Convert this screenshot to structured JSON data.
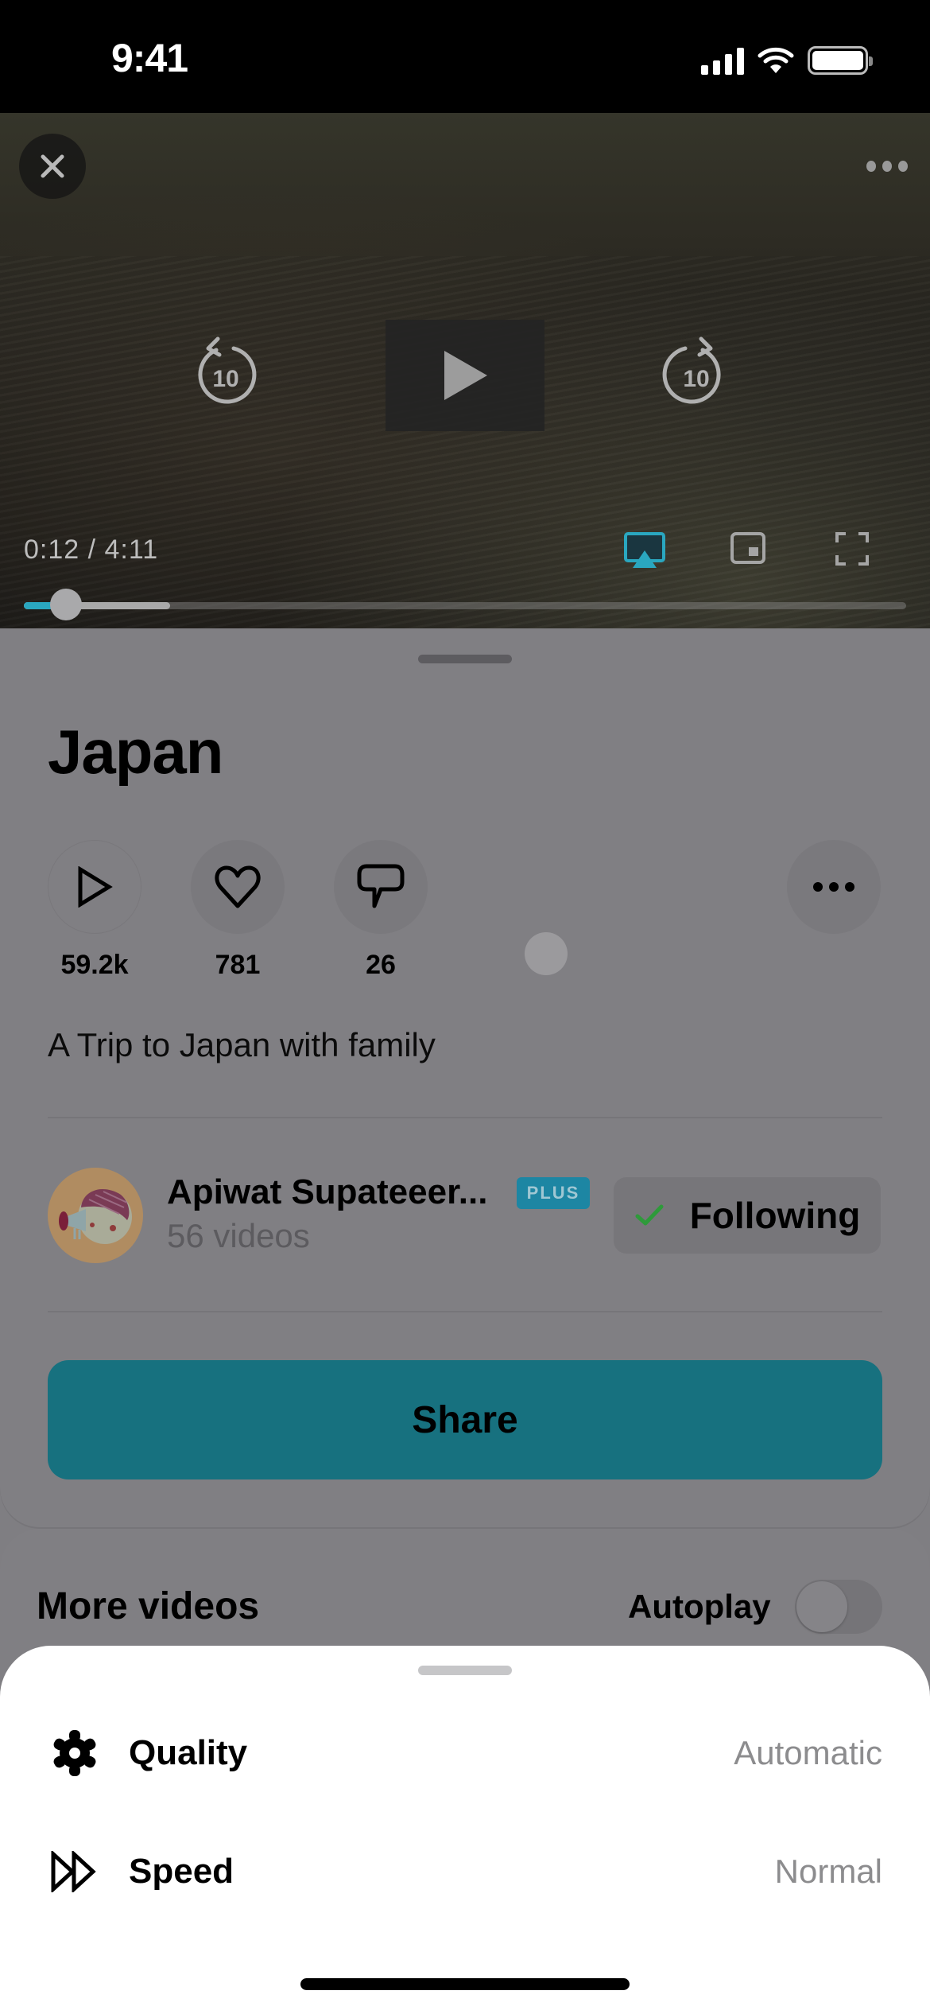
{
  "status_bar": {
    "time": "9:41",
    "icons": [
      "cellular-signal-icon",
      "wifi-icon",
      "battery-icon"
    ]
  },
  "player": {
    "close_icon": "close-icon",
    "more_icon": "more-horizontal-icon",
    "skip_back_label": "10",
    "skip_forward_label": "10",
    "play_icon": "play-icon",
    "time_current": "0:12",
    "time_total": "4:11",
    "time_display": "0:12 / 4:11",
    "progress_played_fraction": 0.048,
    "progress_buffered_fraction": 0.166,
    "controls": [
      "airplay-icon",
      "picture-in-picture-icon",
      "fullscreen-icon"
    ],
    "accent_color": "#2aa7c0"
  },
  "video": {
    "title": "Japan",
    "stats": [
      {
        "icon": "play-icon",
        "count": "59.2k"
      },
      {
        "icon": "heart-icon",
        "count": "781"
      },
      {
        "icon": "comment-icon",
        "count": "26"
      }
    ],
    "description": "A Trip to Japan with family"
  },
  "author": {
    "name": "Apiwat Supateeer...",
    "badge": "PLUS",
    "subtitle": "56 videos",
    "follow_label": "Following",
    "badge_color": "#1d86a3",
    "check_color": "#2e9a3a"
  },
  "share": {
    "label": "Share",
    "color": "#17717f"
  },
  "more_videos": {
    "title": "More videos",
    "autoplay_label": "Autoplay",
    "autoplay_on": false
  },
  "settings_sheet": {
    "rows": [
      {
        "icon": "gear-icon",
        "label": "Quality",
        "value": "Automatic"
      },
      {
        "icon": "fast-forward-icon",
        "label": "Speed",
        "value": "Normal"
      }
    ]
  }
}
